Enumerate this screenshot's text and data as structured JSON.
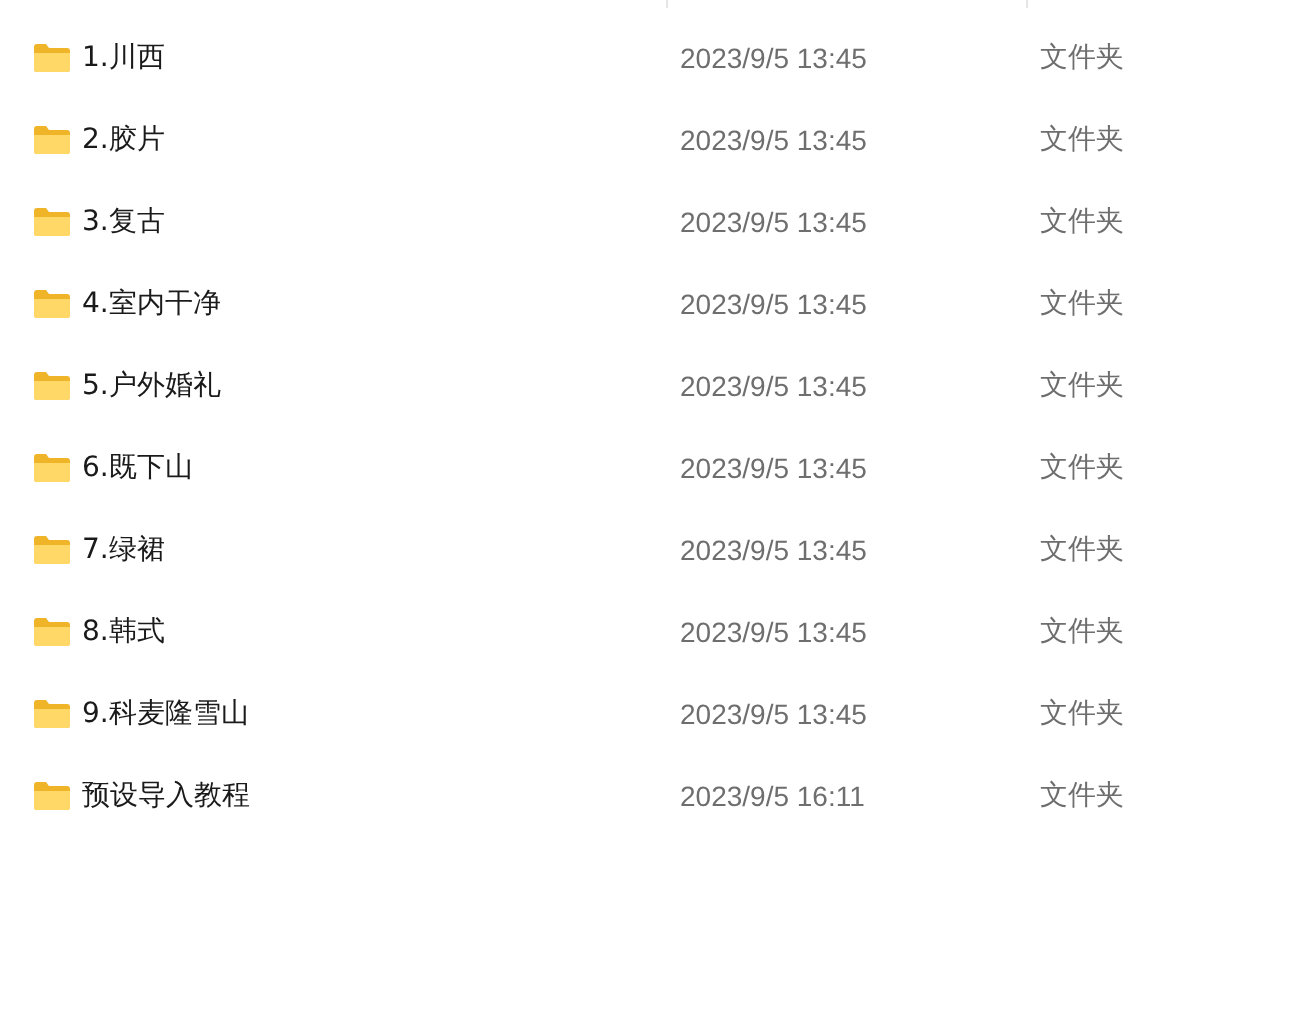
{
  "files": [
    {
      "name": "1.川西",
      "modified": "2023/9/5 13:45",
      "type": "文件夹"
    },
    {
      "name": "2.胶片",
      "modified": "2023/9/5 13:45",
      "type": "文件夹"
    },
    {
      "name": "3.复古",
      "modified": "2023/9/5 13:45",
      "type": "文件夹"
    },
    {
      "name": "4.室内干净",
      "modified": "2023/9/5 13:45",
      "type": "文件夹"
    },
    {
      "name": "5.户外婚礼",
      "modified": "2023/9/5 13:45",
      "type": "文件夹"
    },
    {
      "name": "6.既下山",
      "modified": "2023/9/5 13:45",
      "type": "文件夹"
    },
    {
      "name": "7.绿裙",
      "modified": "2023/9/5 13:45",
      "type": "文件夹"
    },
    {
      "name": "8.韩式",
      "modified": "2023/9/5 13:45",
      "type": "文件夹"
    },
    {
      "name": "9.科麦隆雪山",
      "modified": "2023/9/5 13:45",
      "type": "文件夹"
    },
    {
      "name": "预设导入教程",
      "modified": "2023/9/5 16:11",
      "type": "文件夹"
    }
  ]
}
